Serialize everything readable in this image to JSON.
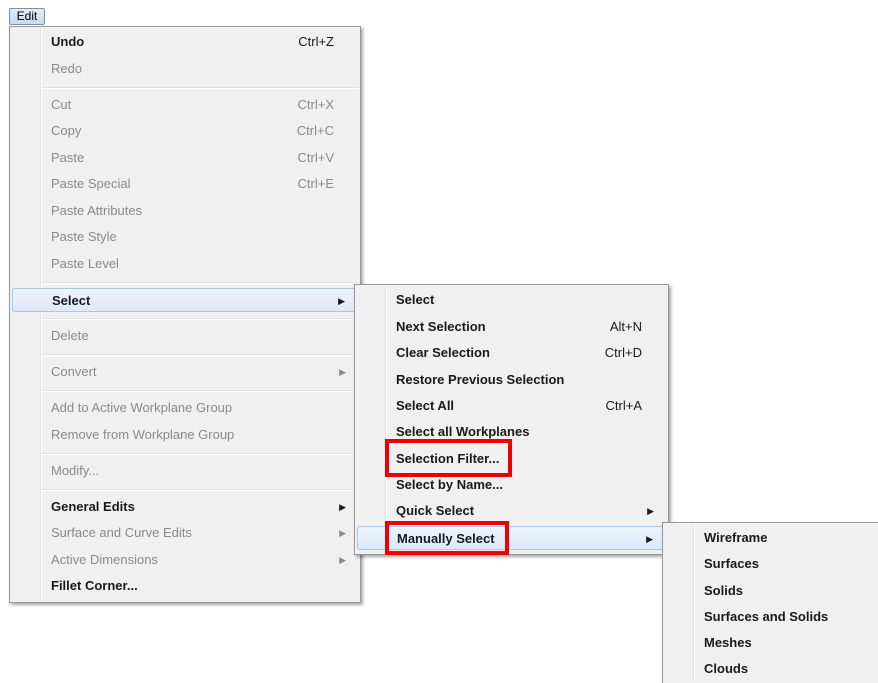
{
  "menubar": {
    "edit_label": "Edit"
  },
  "edit_menu": {
    "undo": {
      "label": "Undo",
      "shortcut": "Ctrl+Z"
    },
    "redo": {
      "label": "Redo"
    },
    "cut": {
      "label": "Cut",
      "shortcut": "Ctrl+X"
    },
    "copy": {
      "label": "Copy",
      "shortcut": "Ctrl+C"
    },
    "paste": {
      "label": "Paste",
      "shortcut": "Ctrl+V"
    },
    "paste_special": {
      "label": "Paste Special",
      "shortcut": "Ctrl+E"
    },
    "paste_attributes": {
      "label": "Paste Attributes"
    },
    "paste_style": {
      "label": "Paste Style"
    },
    "paste_level": {
      "label": "Paste Level"
    },
    "select": {
      "label": "Select"
    },
    "delete": {
      "label": "Delete"
    },
    "convert": {
      "label": "Convert"
    },
    "add_to_group": {
      "label": "Add to Active Workplane Group"
    },
    "remove_from_group": {
      "label": "Remove from Workplane Group"
    },
    "modify": {
      "label": "Modify..."
    },
    "general_edits": {
      "label": "General Edits"
    },
    "surface_curve_edits": {
      "label": "Surface and Curve Edits"
    },
    "active_dimensions": {
      "label": "Active Dimensions"
    },
    "fillet_corner": {
      "label": "Fillet Corner..."
    }
  },
  "select_menu": {
    "select": {
      "label": "Select"
    },
    "next_selection": {
      "label": "Next Selection",
      "shortcut": "Alt+N"
    },
    "clear_selection": {
      "label": "Clear Selection",
      "shortcut": "Ctrl+D"
    },
    "restore_previous": {
      "label": "Restore Previous Selection"
    },
    "select_all": {
      "label": "Select All",
      "shortcut": "Ctrl+A"
    },
    "select_all_workplanes": {
      "label": "Select all Workplanes"
    },
    "selection_filter": {
      "label": "Selection Filter..."
    },
    "select_by_name": {
      "label": "Select by Name..."
    },
    "quick_select": {
      "label": "Quick Select"
    },
    "manually_select": {
      "label": "Manually Select"
    }
  },
  "manual_menu": {
    "items": [
      "Wireframe",
      "Surfaces",
      "Solids",
      "Surfaces and Solids",
      "Meshes",
      "Clouds"
    ]
  },
  "colors": {
    "highlight_border": "#a9c6eb",
    "annotation_red": "#ee0000",
    "disabled_text": "#8a8a8a"
  }
}
